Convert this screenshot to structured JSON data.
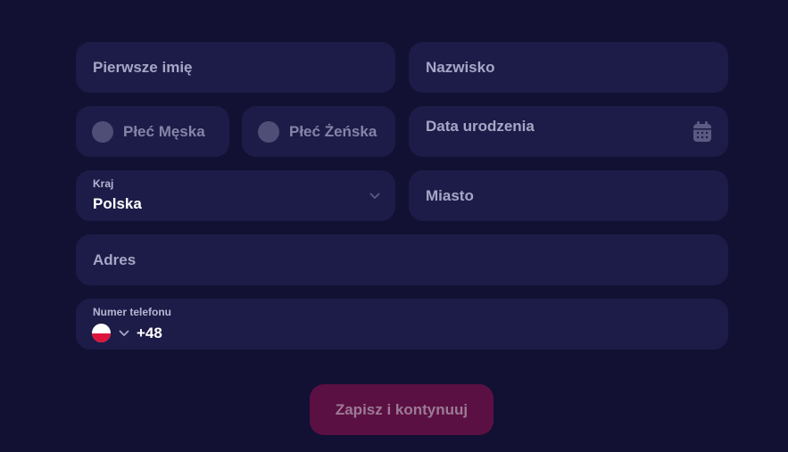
{
  "form": {
    "first_name": {
      "placeholder": "Pierwsze imię"
    },
    "last_name": {
      "placeholder": "Nazwisko"
    },
    "gender": {
      "male_label": "Płeć Męska",
      "female_label": "Płeć Żeńska"
    },
    "birth_date": {
      "placeholder": "Data urodzenia"
    },
    "country": {
      "label": "Kraj",
      "value": "Polska"
    },
    "city": {
      "placeholder": "Miasto"
    },
    "address": {
      "placeholder": "Adres"
    },
    "phone": {
      "label": "Numer telefonu",
      "prefix": "+48"
    },
    "submit_label": "Zapisz i kontynuuj"
  },
  "colors": {
    "background": "#121133",
    "field": "#1d1c48",
    "button": "#5b1043"
  }
}
